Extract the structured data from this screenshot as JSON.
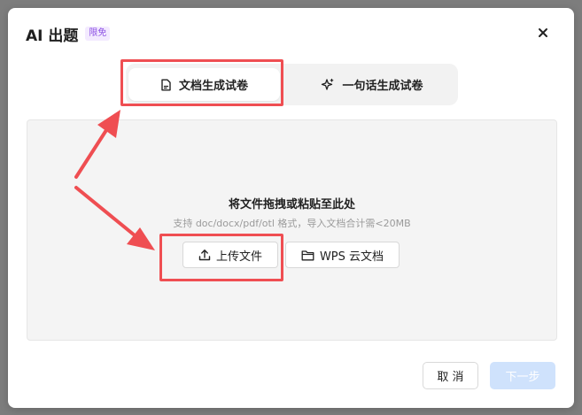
{
  "dialog": {
    "title": "AI 出题",
    "badge": "限免",
    "close_label": "×"
  },
  "tabs": [
    {
      "label": "文档生成试卷",
      "icon": "document-icon",
      "active": true
    },
    {
      "label": "一句话生成试卷",
      "icon": "sparkle-icon",
      "active": false
    }
  ],
  "dropzone": {
    "title": "将文件拖拽或粘贴至此处",
    "hint": "支持 doc/docx/pdf/otl 格式，导入文档合计需<20MB",
    "upload_label": "上传文件",
    "upload_icon": "upload-icon",
    "wps_label": "WPS 云文档",
    "wps_icon": "folder-icon"
  },
  "footer": {
    "cancel_label": "取 消",
    "next_label": "下一步"
  },
  "colors": {
    "accent_red": "#ef4e52",
    "badge_purple": "#8b4fe3",
    "next_disabled": "#cfe2fc"
  }
}
